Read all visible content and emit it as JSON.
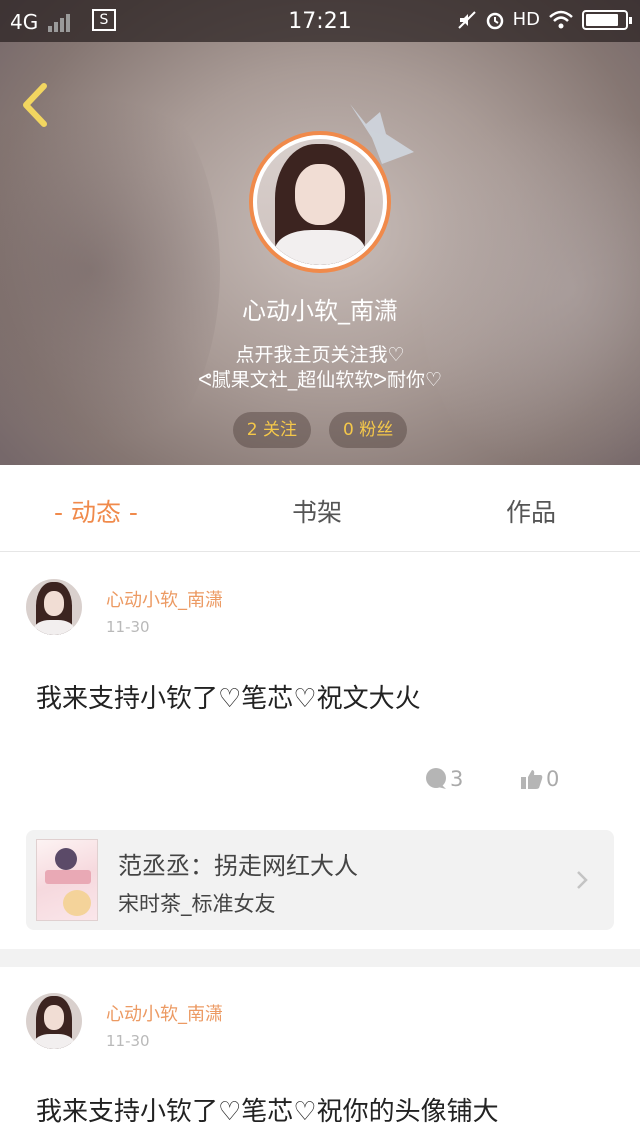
{
  "status_bar": {
    "network": "4G",
    "time": "17:21",
    "hd": "HD"
  },
  "profile": {
    "username": "心动小软_南潇",
    "bio_line1": "点开我主页关注我♡",
    "bio_line2": "ᕙ腻果文社_超仙软软ᕗ耐你♡",
    "following": "2 关注",
    "followers": "0 粉丝"
  },
  "tabs": [
    {
      "label": "- 动态 -"
    },
    {
      "label": "书架"
    },
    {
      "label": "作品"
    }
  ],
  "posts": [
    {
      "author": "心动小软_南潇",
      "date": "11-30",
      "text": "我来支持小钦了♡笔芯♡祝文大火",
      "comments": "3",
      "likes": "0",
      "book": {
        "title": "范丞丞：拐走网红大人",
        "author": "宋时茶_标准女友"
      }
    },
    {
      "author": "心动小软_南潇",
      "date": "11-30",
      "text": "我来支持小钦了♡笔芯♡祝你的头像铺大"
    }
  ],
  "colors": {
    "accent": "#f08a4b",
    "name": "#ec9a63",
    "pill_text": "#f5c84a"
  }
}
